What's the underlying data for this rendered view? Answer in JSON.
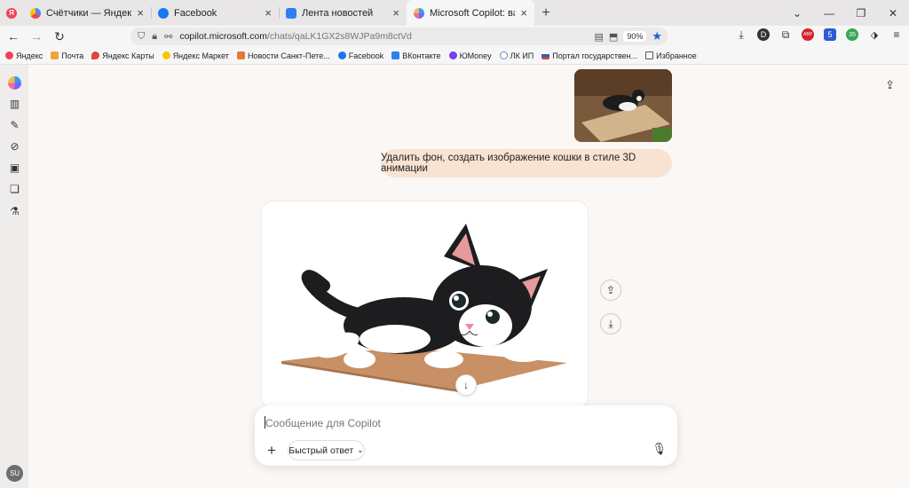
{
  "browser": {
    "logo_letter": "Я",
    "tabs": [
      {
        "title": "Счётчики — Яндекс.Метрика",
        "color": "#4c8af5"
      },
      {
        "title": "Facebook",
        "color": "#1877f2"
      },
      {
        "title": "Лента новостей",
        "color": "#2f7ff0"
      },
      {
        "title": "Microsoft Copilot: ваш ИИ-пом",
        "color": "#7b61ff"
      }
    ],
    "new_tab": "+",
    "close": "×",
    "window_controls": [
      "⌄",
      "—",
      "❐",
      "✕"
    ],
    "url_host": "copilot.microsoft.com",
    "url_path": "/chats/qaLK1GX2s8WJPa9m8ctVd",
    "zoom": "90%",
    "extensions": [
      "D",
      "ABP",
      "5",
      "35"
    ],
    "bookmarks": [
      {
        "label": "Яндекс",
        "color": "#f0435a"
      },
      {
        "label": "Почта",
        "color": "#f0a53a"
      },
      {
        "label": "Яндекс Карты",
        "color": "#e2463b"
      },
      {
        "label": "Яндекс Маркет",
        "color": "#f7c600"
      },
      {
        "label": "Новости Санкт-Пете...",
        "color": "#e07a3d"
      },
      {
        "label": "Facebook",
        "color": "#1877f2"
      },
      {
        "label": "ВКонтакте",
        "color": "#2f7ff0"
      },
      {
        "label": "ЮMoney",
        "color": "#7a3ff2"
      },
      {
        "label": "ЛК ИП",
        "color": "#6b8bb0"
      },
      {
        "label": "Портал государствен...",
        "color": "#d6403a"
      },
      {
        "label": "Избранное",
        "color": "#c9b27b"
      }
    ]
  },
  "sidebar": {
    "avatar_initials": "SU"
  },
  "chat": {
    "user_message": "Удалить фон, создать изображение кошки в стиле 3D анимации",
    "composer_placeholder": "Сообщение для Copilot",
    "mode_label": "Быстрый ответ"
  },
  "colors": {
    "accent_star": "#1a62d8",
    "user_bubble": "#f8e3d2"
  }
}
